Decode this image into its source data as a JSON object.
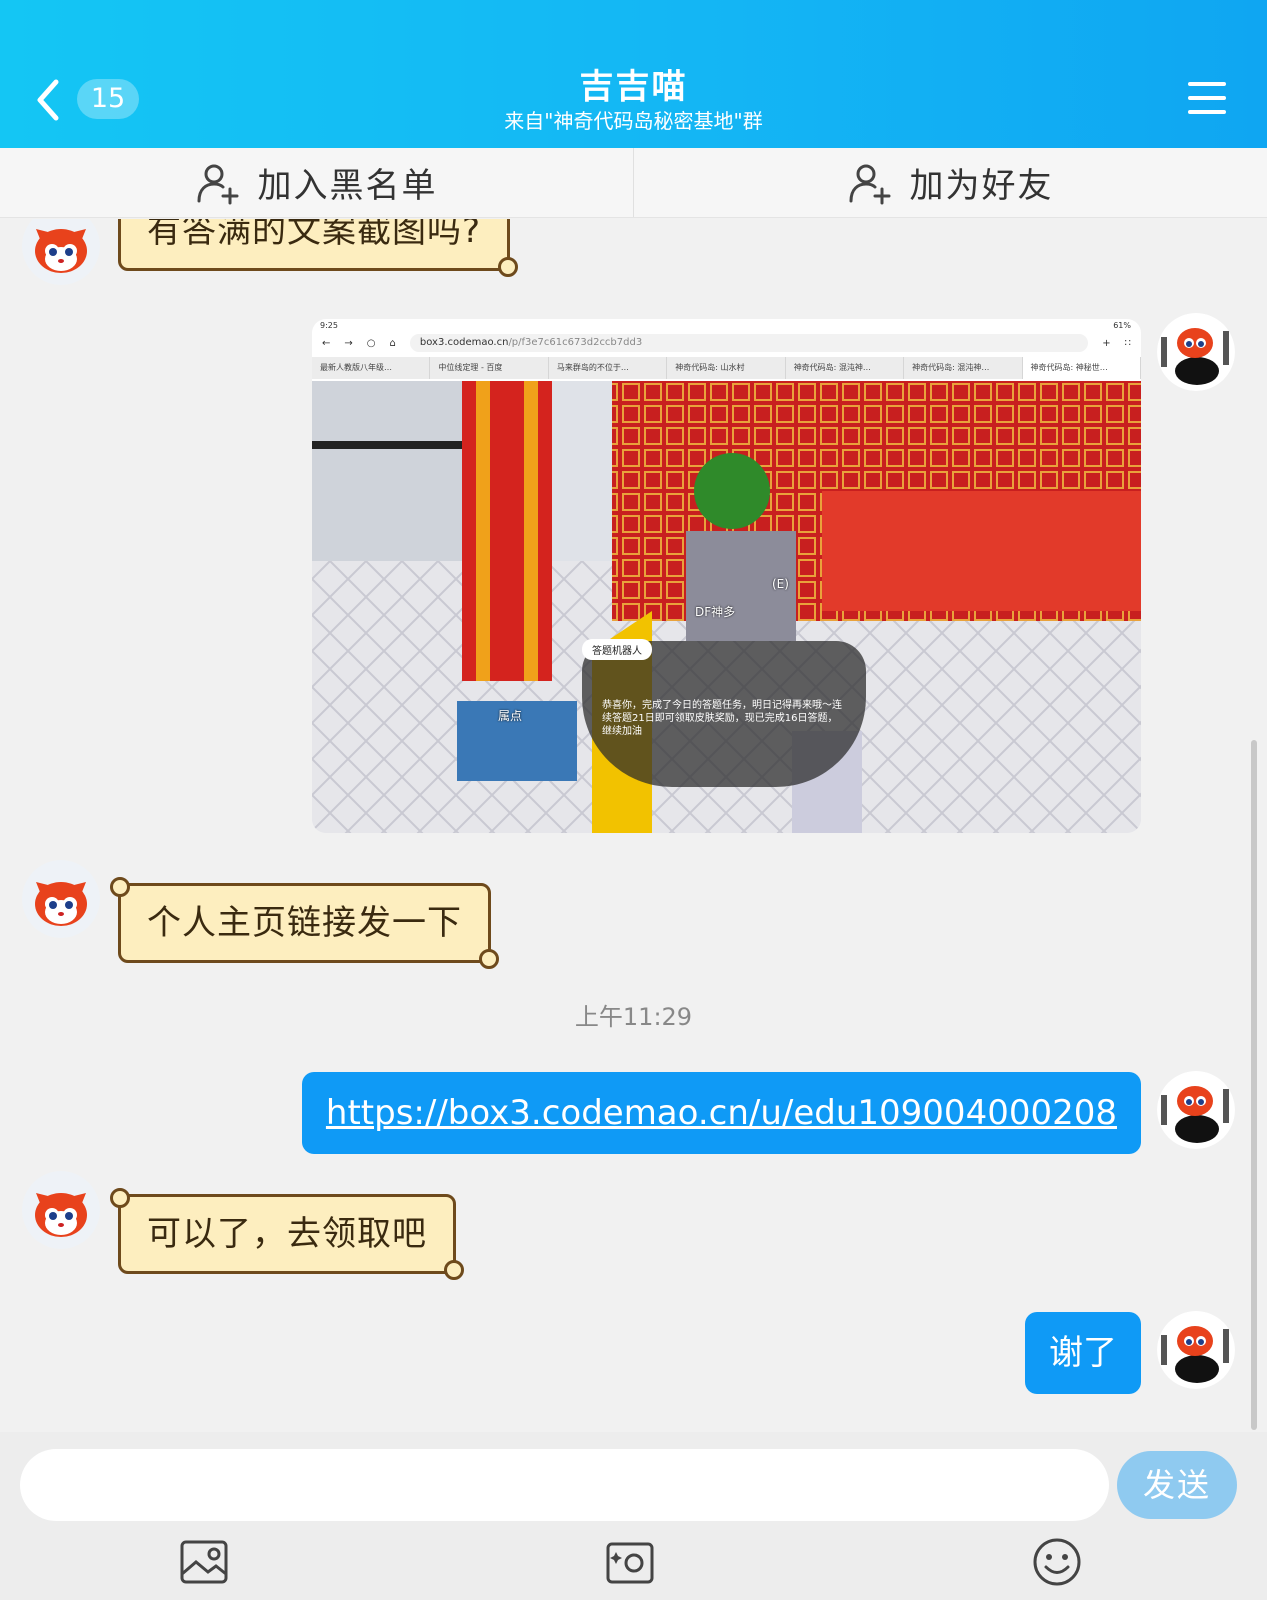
{
  "header": {
    "title": "吉吉喵",
    "subtitle": "来自\"神奇代码岛秘密基地\"群",
    "unread_count": "15",
    "icons": {
      "back": "chevron-left-icon",
      "menu": "hamburger-menu-icon"
    }
  },
  "actions": {
    "blacklist_label": "加入黑名单",
    "add_friend_label": "加为好友"
  },
  "messages": [
    {
      "side": "left",
      "type": "text",
      "text": "有答满的文案截图吗?"
    },
    {
      "side": "right",
      "type": "image",
      "screenshot": {
        "status_time": "9:25",
        "status_battery": "61%",
        "url_host": "box3.codemao.cn",
        "url_path": "/p/f3e7c61c673d2ccb7dd3",
        "tabs": [
          "最新人教版八年级…",
          "中位线定理 - 百度",
          "马来群岛的不位于…",
          "神奇代码岛: 山水村",
          "神奇代码岛: 混沌神…",
          "神奇代码岛: 混沌神…",
          "神奇代码岛: 神秘世…"
        ],
        "game_labels": {
          "df": "DF神多",
          "robot": "答题机器人",
          "e_key": "(E)",
          "spawn": "属点",
          "dialog": "恭喜你，完成了今日的答题任务，明日记得再来哦～连续答题21日即可领取皮肤奖励，现已完成16日答题，继续加油"
        }
      }
    },
    {
      "side": "left",
      "type": "text",
      "text": "个人主页链接发一下"
    },
    {
      "type": "timestamp",
      "text": "上午11:29"
    },
    {
      "side": "right",
      "type": "link",
      "text": "https://box3.codemao.cn/u/edu109004000208"
    },
    {
      "side": "left",
      "type": "text",
      "text": "可以了，去领取吧"
    },
    {
      "side": "right",
      "type": "text",
      "text": "谢了"
    }
  ],
  "input": {
    "placeholder": "",
    "value": "",
    "send_label": "发送",
    "tools": [
      "image-picker-icon",
      "camera-icon",
      "emoji-icon"
    ]
  },
  "colors": {
    "header_gradient_start": "#14c6f4",
    "header_gradient_end": "#0fa6f2",
    "self_bubble": "#0f9af6",
    "cat_bubble_fill": "#fdeebf",
    "cat_bubble_border": "#6e4a1c",
    "send_button": "#8fcaf0"
  }
}
